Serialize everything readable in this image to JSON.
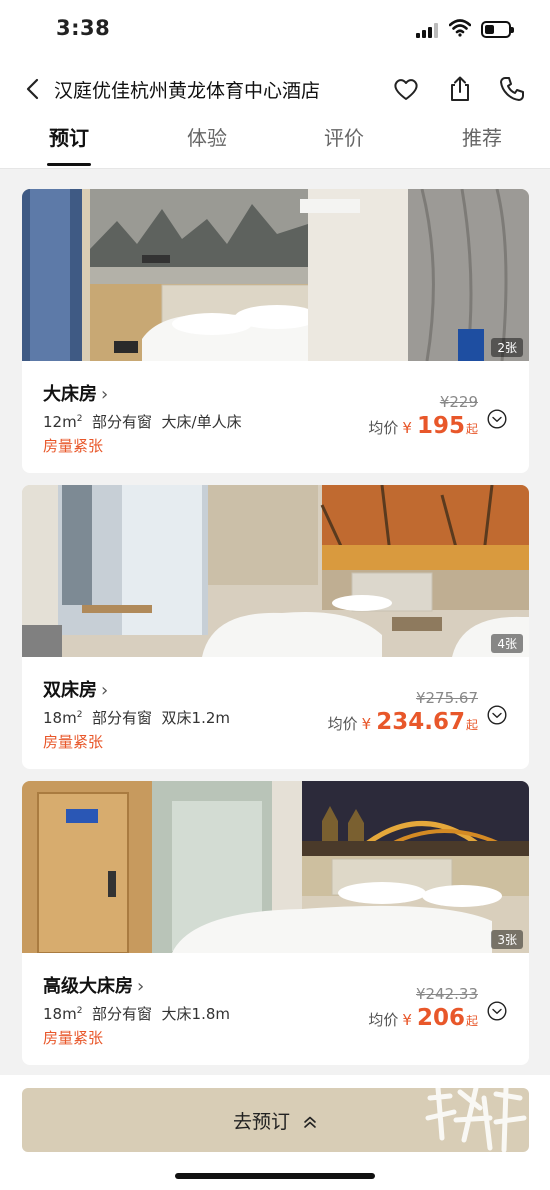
{
  "status_bar": {
    "time": "3:38"
  },
  "header": {
    "title": "汉庭优佳杭州黄龙体育中心酒店",
    "tabs": [
      "预订",
      "体验",
      "评价",
      "推荐"
    ]
  },
  "rooms": [
    {
      "name": "大床房",
      "area": "12m",
      "area_unit": "2",
      "window": "部分有窗",
      "bed": "大床/单人床",
      "status": "房量紧张",
      "bed_count": "2张",
      "original_price": "¥229",
      "price_label": "均价",
      "currency": "¥",
      "price": "195",
      "price_suffix": "起"
    },
    {
      "name": "双床房",
      "area": "18m",
      "area_unit": "2",
      "window": "部分有窗",
      "bed": "双床1.2m",
      "status": "房量紧张",
      "bed_count": "4张",
      "original_price": "¥275.67",
      "price_label": "均价",
      "currency": "¥",
      "price": "234.67",
      "price_suffix": "起"
    },
    {
      "name": "高级大床房",
      "area": "18m",
      "area_unit": "2",
      "window": "部分有窗",
      "bed": "大床1.8m",
      "status": "房量紧张",
      "bed_count": "3张",
      "original_price": "¥242.33",
      "price_label": "均价",
      "currency": "¥",
      "price": "206",
      "price_suffix": "起"
    }
  ],
  "bottom": {
    "book_label": "去预订"
  },
  "colors": {
    "accent": "#e8572a",
    "button": "#d8cdb6"
  },
  "icons": [
    "back-icon",
    "heart-icon",
    "share-icon",
    "phone-icon",
    "chevron-right-icon",
    "expand-circle-icon",
    "double-chevron-up-icon"
  ]
}
